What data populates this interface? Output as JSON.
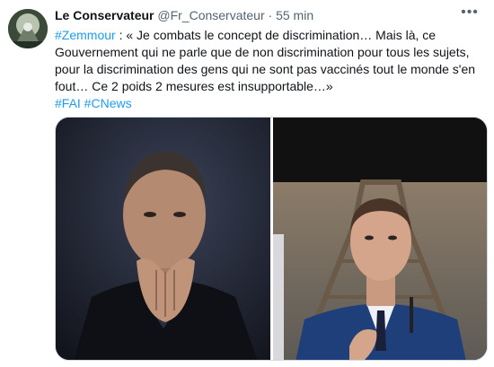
{
  "tweet": {
    "author_name": "Le Conservateur",
    "handle": "@Fr_Conservateur",
    "separator": "·",
    "time": "55 min",
    "more_icon": "more-horizontal-icon",
    "hashtag_lead": "#Zemmour",
    "text": " : « Je combats le concept de discrimination… Mais là, ce Gouvernement qui ne parle que de non discrimination pour tous les sujets, pour la discrimination des gens qui ne sont pas vaccinés tout le monde s'en fout… Ce 2 poids 2 mesures est insupportable…»",
    "hashtags": "#FAI #CNews"
  },
  "colors": {
    "link": "#1d9bf0",
    "secondary_text": "#536471",
    "primary_text": "#0f1419"
  }
}
